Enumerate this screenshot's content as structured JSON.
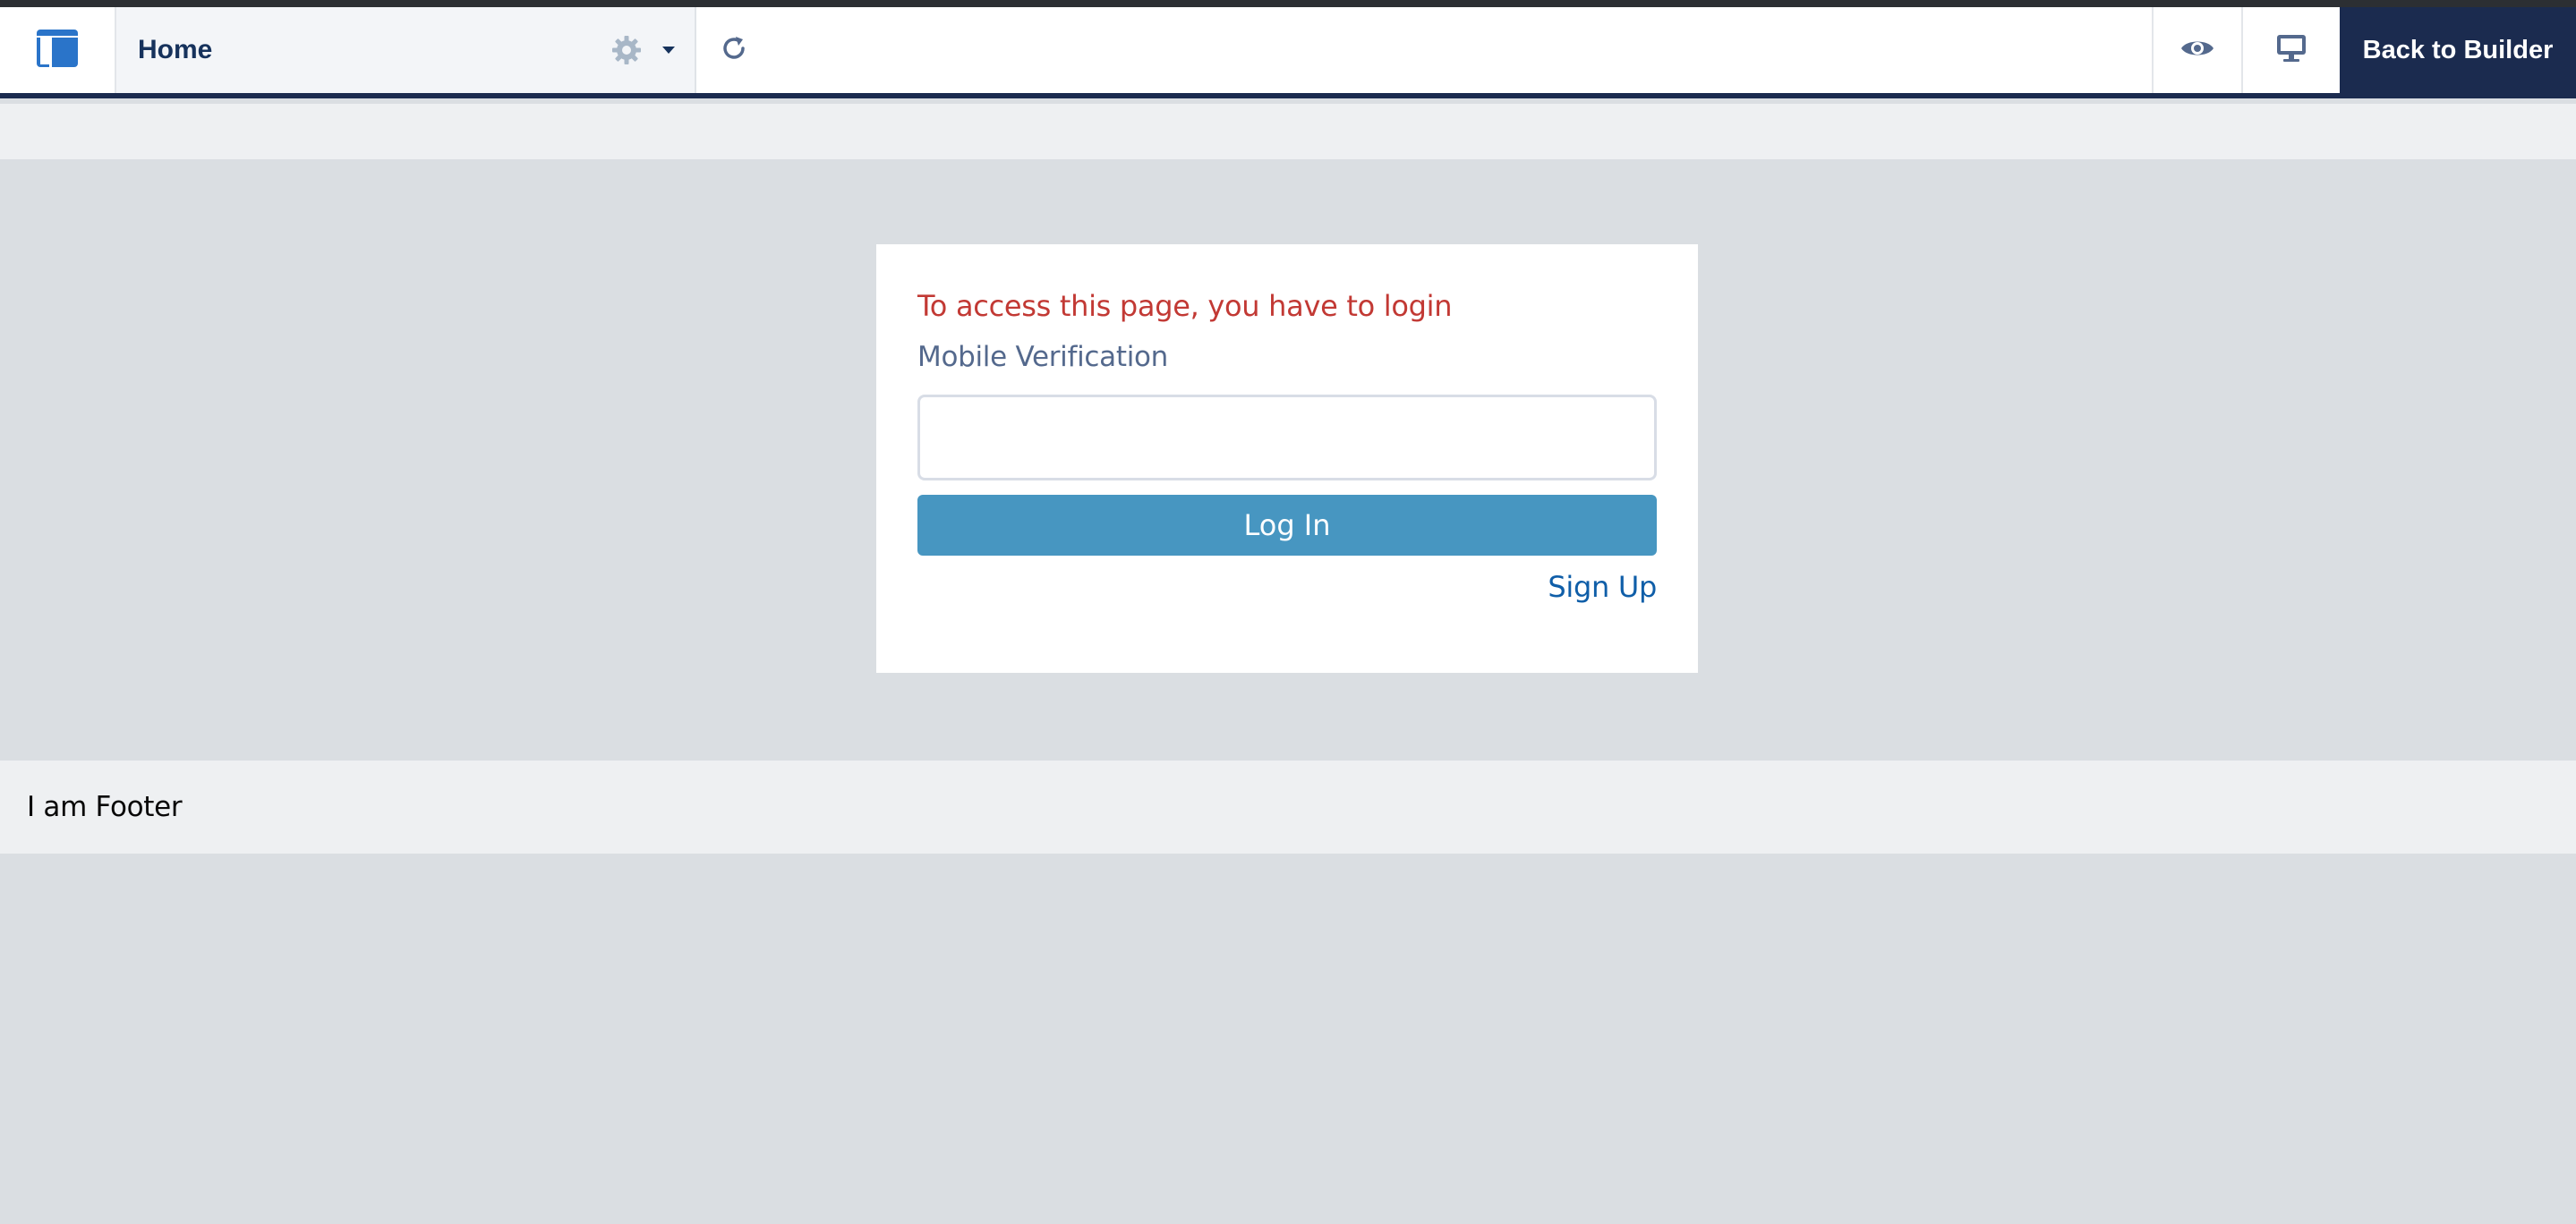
{
  "topbar": {
    "icons": {
      "app": "layout-icon",
      "settings": "gear-icon",
      "dropdown": "chevron-down-icon",
      "refresh": "refresh-icon",
      "preview": "eye-icon",
      "device": "desktop-icon"
    },
    "page_name": "Home",
    "back_label": "Back to Builder"
  },
  "login": {
    "message": "To access this page, you have to login",
    "field_label": "Mobile Verification",
    "input_value": "",
    "input_placeholder": "",
    "login_label": "Log In",
    "signup_label": "Sign Up"
  },
  "footer": {
    "text": "I am Footer"
  },
  "colors": {
    "navy": "#1b2b4f",
    "error_red": "#c23934",
    "button_blue": "#4796c1",
    "link_blue": "#0f5ea8",
    "background_gray": "#dadee2",
    "band_gray": "#eef0f2"
  }
}
